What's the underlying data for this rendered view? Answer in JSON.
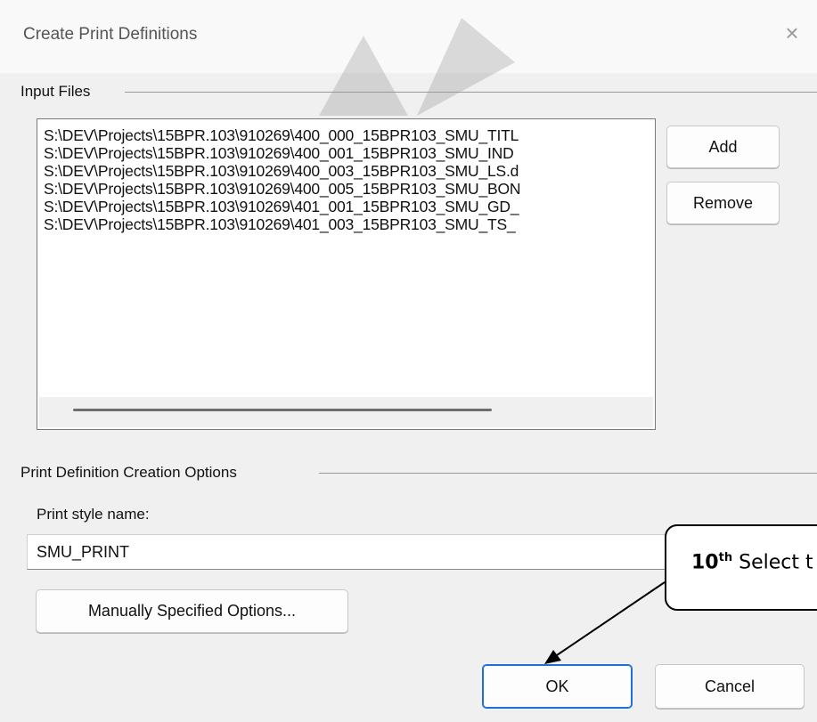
{
  "window": {
    "title": "Create Print Definitions",
    "close_glyph": "×"
  },
  "input_files": {
    "group_label": "Input Files",
    "files": [
      "S:\\DEV\\Projects\\15BPR.103\\910269\\400_000_15BPR103_SMU_TITL",
      "S:\\DEV\\Projects\\15BPR.103\\910269\\400_001_15BPR103_SMU_IND",
      "S:\\DEV\\Projects\\15BPR.103\\910269\\400_003_15BPR103_SMU_LS.d",
      "S:\\DEV\\Projects\\15BPR.103\\910269\\400_005_15BPR103_SMU_BON",
      "S:\\DEV\\Projects\\15BPR.103\\910269\\401_001_15BPR103_SMU_GD_",
      "S:\\DEV\\Projects\\15BPR.103\\910269\\401_003_15BPR103_SMU_TS_"
    ],
    "add_label": "Add",
    "remove_label": "Remove"
  },
  "options": {
    "group_label": "Print Definition Creation Options",
    "style_label": "Print style name:",
    "style_value": "SMU_PRINT",
    "manual_label": "Manually Specified Options..."
  },
  "footer": {
    "ok_label": "OK",
    "cancel_label": "Cancel"
  },
  "annotation": {
    "number": "10",
    "suffix": "th",
    "text": " Select t"
  },
  "colors": {
    "accent": "#1f6fd4",
    "dialog_bg": "#f0f0f0"
  }
}
